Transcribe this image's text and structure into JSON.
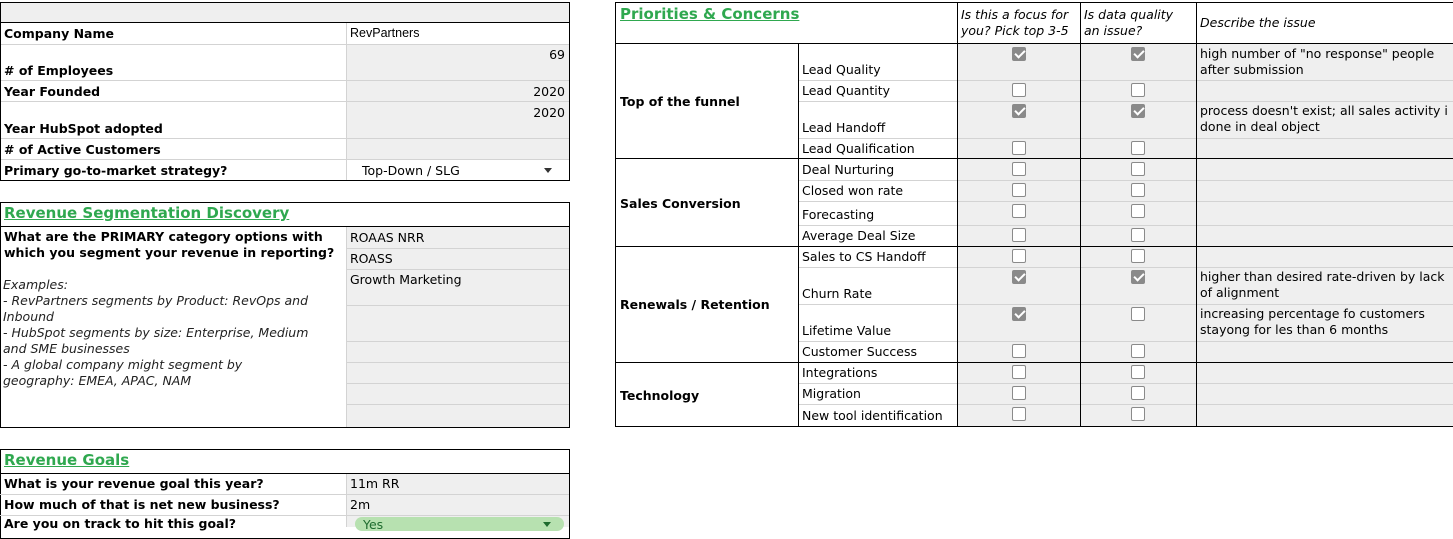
{
  "company": {
    "rows": [
      {
        "label": "Company Name",
        "value": "RevPartners"
      },
      {
        "label": "# of Employees",
        "value": "69"
      },
      {
        "label": "Year Founded",
        "value": "2020"
      },
      {
        "label": "Year HubSpot adopted",
        "value": "2020"
      },
      {
        "label": "# of Active Customers",
        "value": ""
      },
      {
        "label": "Primary go-to-market strategy?",
        "value": "Top-Down / SLG"
      }
    ]
  },
  "segmentation": {
    "title": "Revenue Segmentation Discovery",
    "question": "What are the PRIMARY category options with which you segment your revenue in reporting?",
    "examples": [
      "Examples:",
      "- RevPartners segments by Product: RevOps and",
      "Inbound",
      "- HubSpot segments by size: Enterprise, Medium",
      "and SME businesses",
      "- A global company might segment by",
      "geography: EMEA, APAC, NAM"
    ],
    "options": [
      "ROAAS NRR",
      "ROASS",
      "Growth Marketing",
      "",
      "",
      "",
      "",
      ""
    ]
  },
  "goals": {
    "title": "Revenue Goals",
    "rows": [
      {
        "label": "What is your revenue goal this year?",
        "value": "11m RR"
      },
      {
        "label": "How much of that is net new business?",
        "value": "2m"
      },
      {
        "label": "Are you on track to hit this goal?",
        "value": "Yes"
      }
    ]
  },
  "priorities": {
    "title": "Priorities & Concerns",
    "headers": {
      "focus": [
        "Is this a focus for",
        "you? Pick top 3-5"
      ],
      "quality": [
        "Is data quality",
        "an issue?"
      ],
      "describe": "Describe the issue"
    },
    "groups": [
      {
        "name": "Top of the funnel"
      },
      {
        "name": "Sales Conversion"
      },
      {
        "name": "Renewals / Retention"
      },
      {
        "name": "Technology"
      }
    ],
    "items": [
      {
        "label": "Lead Quality",
        "focus": true,
        "quality": true,
        "issue": [
          "high number of \"no response\" people",
          "after submission"
        ]
      },
      {
        "label": "Lead Quantity",
        "focus": false,
        "quality": false,
        "issue": []
      },
      {
        "label": "Lead Handoff",
        "focus": true,
        "quality": true,
        "issue": [
          "process doesn't exist; all sales activity i",
          "done in deal object"
        ]
      },
      {
        "label": "Lead Qualification",
        "focus": false,
        "quality": false,
        "issue": []
      },
      {
        "label": "Deal Nurturing",
        "focus": false,
        "quality": false,
        "issue": []
      },
      {
        "label": "Closed won rate",
        "focus": false,
        "quality": false,
        "issue": []
      },
      {
        "label": "Forecasting",
        "focus": false,
        "quality": false,
        "issue": []
      },
      {
        "label": "Average Deal Size",
        "focus": false,
        "quality": false,
        "issue": []
      },
      {
        "label": "Sales to CS Handoff",
        "focus": false,
        "quality": false,
        "issue": []
      },
      {
        "label": "Churn Rate",
        "focus": true,
        "quality": true,
        "issue": [
          "higher than desired rate-driven by lack",
          "of alignment"
        ]
      },
      {
        "label": "Lifetime Value",
        "focus": true,
        "quality": false,
        "issue": [
          "increasing percentage fo customers",
          "stayong for les than 6 months"
        ]
      },
      {
        "label": "Customer Success",
        "focus": false,
        "quality": false,
        "issue": []
      },
      {
        "label": "Integrations",
        "focus": false,
        "quality": false,
        "issue": []
      },
      {
        "label": "Migration",
        "focus": false,
        "quality": false,
        "issue": []
      },
      {
        "label": "New tool identification",
        "focus": false,
        "quality": false,
        "issue": []
      }
    ]
  },
  "colors": {
    "green": "#2fa84f",
    "cell_grey": "#efefef",
    "checkbox_grey": "#8a8a8a",
    "chip_green": "#b7e1b0"
  }
}
